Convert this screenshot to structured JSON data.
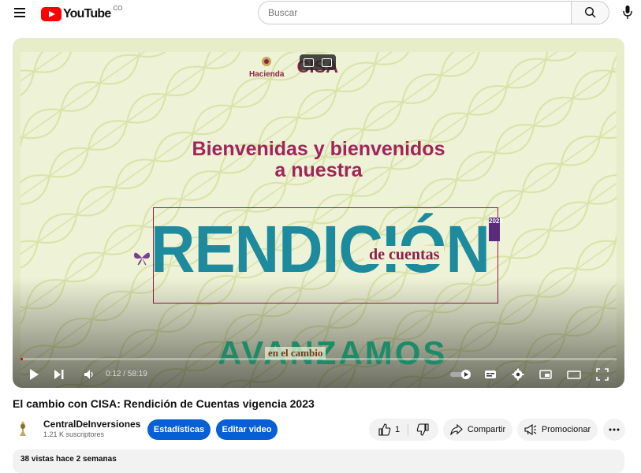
{
  "header": {
    "logo_text": "YouTube",
    "country_code": "CO",
    "search_placeholder": "Buscar"
  },
  "player": {
    "overlay": {
      "brand_left": "Hacienda",
      "brand_right": "CISA",
      "welcome_line1": "Bienvenidas y bienvenidos",
      "welcome_line2": "a nuestra",
      "headline": "RENDICIÓN",
      "subheadline": "de cuentas",
      "year": "2023",
      "slogan": "AVANZAMOS",
      "slogan_sub": "en el cambio"
    },
    "current_time": "0:12",
    "duration": "58:19",
    "time_display": "0:12 / 58:19",
    "progress_fraction": 0.0034,
    "accent_color": "#ff0000"
  },
  "video": {
    "title": "El cambio con CISA: Rendición de Cuentas vigencia 2023",
    "channel_name": "CentralDeInversiones",
    "subscribers": "1.21 K suscriptores",
    "stats_button": "Estadísticas",
    "edit_button": "Editar video",
    "like_count": "1",
    "share_label": "Compartir",
    "promote_label": "Promocionar",
    "views_date": "38 vistas  hace 2 semanas"
  }
}
